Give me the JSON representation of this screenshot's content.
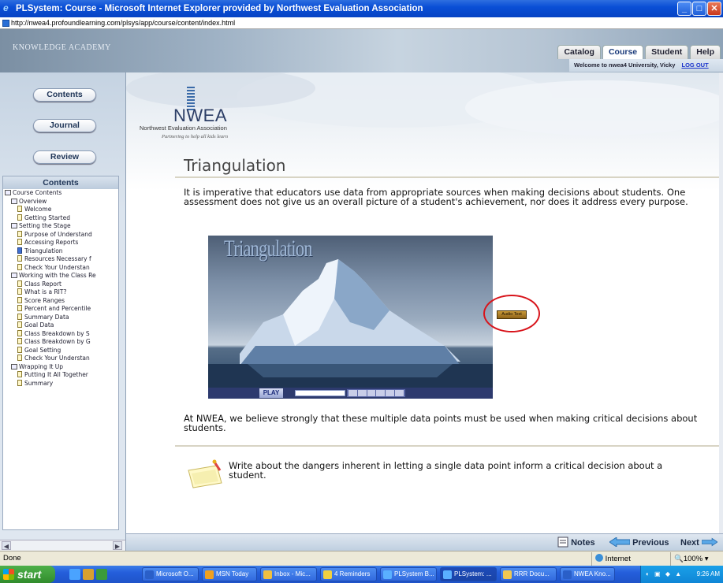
{
  "window": {
    "title": "PLSystem: Course - Microsoft Internet Explorer provided by Northwest Evaluation Association",
    "url": "http://nwea4.profoundlearning.com/plsys/app/course/content/index.html"
  },
  "header": {
    "brand": "KNOWLEDGE ACADEMY",
    "tabs": [
      "Catalog",
      "Course",
      "Student",
      "Help"
    ],
    "active_tab": "Course",
    "welcome": "Welcome to nwea4 University, Vicky",
    "logout": "LOG OUT"
  },
  "leftnav": {
    "contents_button": "Contents",
    "journal_button": "Journal",
    "review_button": "Review",
    "tree_title": "Contents",
    "tree": [
      {
        "label": "Course Contents",
        "level": 0,
        "type": "book"
      },
      {
        "label": "Overview",
        "level": 1,
        "type": "book"
      },
      {
        "label": "Welcome",
        "level": 2,
        "type": "page"
      },
      {
        "label": "Getting Started",
        "level": 2,
        "type": "page"
      },
      {
        "label": "Setting the Stage",
        "level": 1,
        "type": "book"
      },
      {
        "label": "Purpose of Understand",
        "level": 2,
        "type": "page"
      },
      {
        "label": "Accessing Reports",
        "level": 2,
        "type": "page"
      },
      {
        "label": "Triangulation",
        "level": 2,
        "type": "page",
        "current": true
      },
      {
        "label": "Resources Necessary f",
        "level": 2,
        "type": "page"
      },
      {
        "label": "Check Your Understan",
        "level": 2,
        "type": "page"
      },
      {
        "label": "Working with the Class Re",
        "level": 1,
        "type": "book"
      },
      {
        "label": "Class Report",
        "level": 2,
        "type": "page"
      },
      {
        "label": "What is a RIT?",
        "level": 2,
        "type": "page"
      },
      {
        "label": "Score Ranges",
        "level": 2,
        "type": "page"
      },
      {
        "label": "Percent and Percentile",
        "level": 2,
        "type": "page"
      },
      {
        "label": "Summary Data",
        "level": 2,
        "type": "page"
      },
      {
        "label": "Goal Data",
        "level": 2,
        "type": "page"
      },
      {
        "label": "Class Breakdown by S",
        "level": 2,
        "type": "page"
      },
      {
        "label": "Class Breakdown by G",
        "level": 2,
        "type": "page"
      },
      {
        "label": "Goal Setting",
        "level": 2,
        "type": "page"
      },
      {
        "label": "Check Your Understan",
        "level": 2,
        "type": "page"
      },
      {
        "label": "Wrapping It Up",
        "level": 1,
        "type": "book"
      },
      {
        "label": "Putting It All Together",
        "level": 2,
        "type": "page"
      },
      {
        "label": "Summary",
        "level": 2,
        "type": "page"
      }
    ]
  },
  "content": {
    "logo_name": "NWEA",
    "logo_full": "Northwest Evaluation Association",
    "logo_tagline": "Partnering to help all kids learn",
    "title": "Triangulation",
    "intro": "It is imperative that educators use data from appropriate sources when making decisions about students. One assessment does not give us an overall picture of a student's achievement, nor does it address every purpose.",
    "video_title": "Triangulation",
    "play_label": "PLAY",
    "audio_text_label": "Audio Text",
    "closing": "At NWEA, we believe strongly that these multiple data points must be used when making critical decisions about students.",
    "journal_icon_label": "Journal",
    "journal_prompt": "Write about the dangers inherent in letting a single data point inform a critical decision about a student."
  },
  "bottomnav": {
    "notes": "Notes",
    "previous": "Previous",
    "next": "Next"
  },
  "status": {
    "text": "Done",
    "zone": "Internet",
    "zoom": "100%"
  },
  "taskbar": {
    "start": "start",
    "buttons": [
      "Microsoft O...",
      "MSN Today",
      "Inbox - Mic...",
      "4 Reminders",
      "PLSystem B...",
      "PLSystem: ...",
      "RRR Docu...",
      "NWEA Kno..."
    ],
    "clock": "9:26 AM"
  },
  "colors": {
    "titlebar": "#0a4fd6",
    "accent_red": "#d8141b",
    "taskbar": "#245edb"
  }
}
